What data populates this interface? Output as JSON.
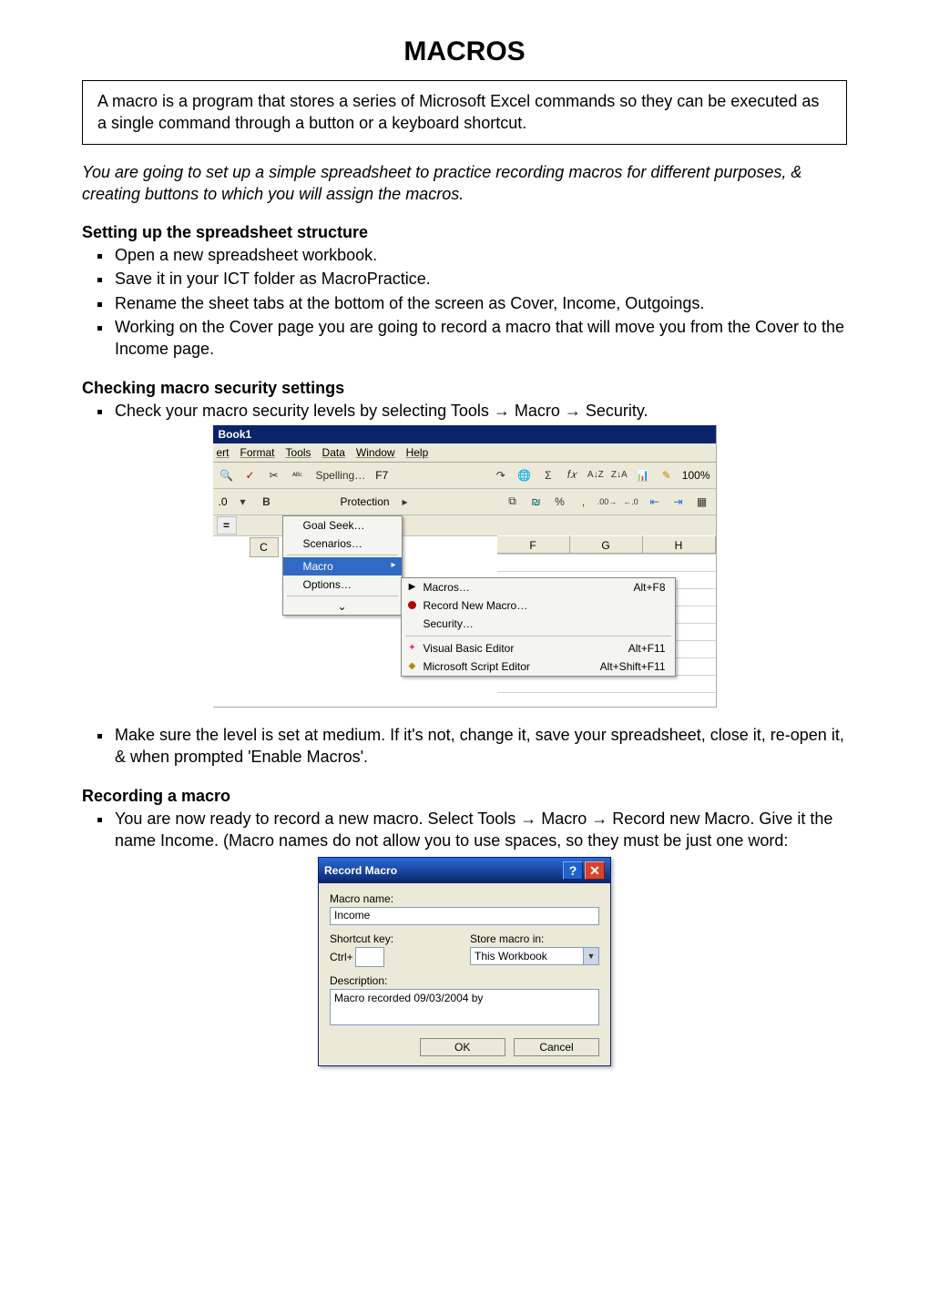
{
  "title": "MACROS",
  "intro": "A macro is a program that stores a series of Microsoft Excel commands so they can be executed as a single command through a button or a keyboard shortcut.",
  "italic_intro": "You are going to set up a simple spreadsheet to practice recording macros for different purposes, & creating buttons to which you will assign the macros.",
  "sections": {
    "setup": {
      "heading": "Setting up the spreadsheet structure",
      "items": [
        "Open a new spreadsheet workbook.",
        "Save it in your ICT folder as MacroPractice.",
        "Rename the sheet tabs at the bottom of the screen as Cover, Income, Outgoings.",
        "Working on the Cover page you are going to record a macro that will move you from the Cover to the Income page."
      ]
    },
    "checking": {
      "heading": "Checking macro security settings",
      "items": [
        "Check your macro security levels by selecting Tools → Macro → Security."
      ],
      "after": "Make sure the level is set at medium.  If it's not, change it, save your spreadsheet, close it, re-open it, & when prompted 'Enable Macros'."
    },
    "recording": {
      "heading": "Recording a macro",
      "items": [
        "You are now ready to record a new macro.  Select Tools → Macro → Record new Macro. Give it the name Income.  (Macro names do not allow you to use spaces, so they must be just one word:"
      ]
    }
  },
  "excel": {
    "title": "Book1",
    "menubar": [
      "ert",
      "Format",
      "Tools",
      "Data",
      "Window",
      "Help"
    ],
    "toolbar1": {
      "zoom": "100%",
      "icons": [
        "print-preview",
        "spellcheck",
        "cut",
        "abc",
        "redo",
        "globe",
        "sigma",
        "fx",
        "sort-asc",
        "sort-desc",
        "chart",
        "drawing"
      ]
    },
    "toolbar2": {
      "left": ".0",
      "b": "B",
      "icons": [
        "merge",
        "currency",
        "percent",
        "comma",
        "inc-dec",
        "dec-dec",
        "dec-indent",
        "inc-indent",
        "borders"
      ]
    },
    "col_headers": [
      "F",
      "G",
      "H"
    ],
    "cellC": "C",
    "eq": "=",
    "tools_menu": {
      "spelling": "Spelling…",
      "spelling_key": "F7",
      "protection": "Protection",
      "goalseek": "Goal Seek…",
      "scenarios": "Scenarios…",
      "macro": "Macro",
      "options": "Options…"
    },
    "macro_submenu": {
      "macros": "Macros…",
      "macros_key": "Alt+F8",
      "record": "Record New Macro…",
      "security": "Security…",
      "vbe": "Visual Basic Editor",
      "vbe_key": "Alt+F11",
      "mse": "Microsoft Script Editor",
      "mse_key": "Alt+Shift+F11"
    }
  },
  "dialog": {
    "title": "Record Macro",
    "name_label": "Macro name:",
    "name_value": "Income",
    "shortcut_label": "Shortcut key:",
    "ctrl": "Ctrl+",
    "store_label": "Store macro in:",
    "store_value": "This Workbook",
    "desc_label": "Description:",
    "desc_value": "Macro recorded 09/03/2004 by",
    "ok": "OK",
    "cancel": "Cancel"
  }
}
